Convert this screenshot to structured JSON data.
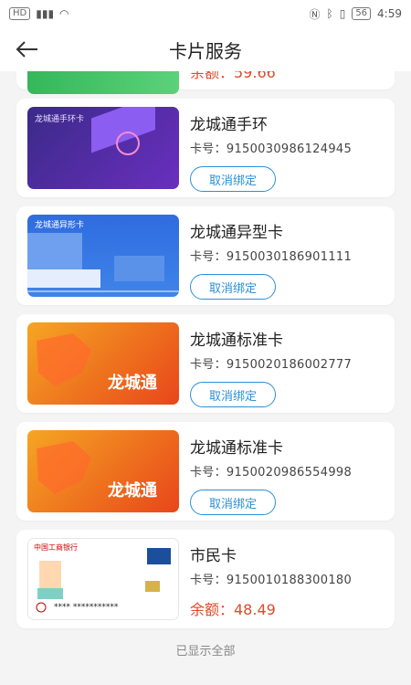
{
  "statusbar": {
    "time": "4:59",
    "left_text": "HD",
    "battery": "56"
  },
  "header": {
    "title": "卡片服务"
  },
  "top_partial": {
    "balance": "余额：59.66"
  },
  "cards": [
    {
      "thumb_label": "龙城通手环卡",
      "name": "龙城通手环",
      "card_no": "卡号：9150030986124945",
      "action": "取消绑定"
    },
    {
      "thumb_label": "龙城通异形卡",
      "name": "龙城通异型卡",
      "card_no": "卡号：9150030186901111",
      "action": "取消绑定"
    },
    {
      "thumb_label": "龙城通",
      "name": "龙城通标准卡",
      "card_no": "卡号：9150020186002777",
      "action": "取消绑定"
    },
    {
      "thumb_label": "龙城通",
      "name": "龙城通标准卡",
      "card_no": "卡号：9150020986554998",
      "action": "取消绑定"
    }
  ],
  "citizen": {
    "name": "市民卡",
    "card_no": "卡号：9150010188300180",
    "balance": "余额：48.49",
    "bank": "中国工商银行",
    "stars": "**** ***********"
  },
  "footer": {
    "text": "已显示全部"
  },
  "colors": {
    "accent": "#2e8fd6",
    "balance": "#e04a2a"
  }
}
